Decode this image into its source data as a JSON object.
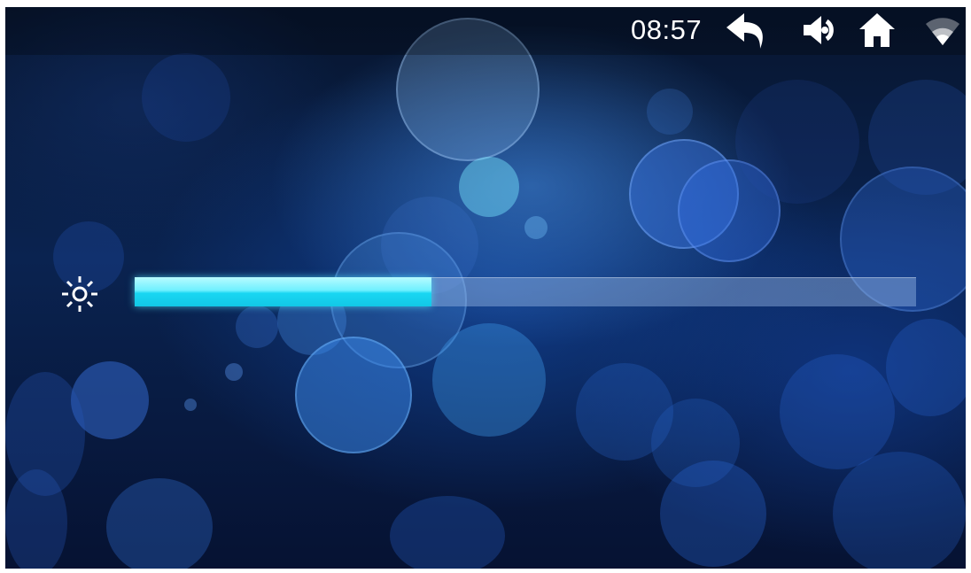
{
  "status_bar": {
    "time": "08:57",
    "icons": [
      "back-arrow-icon",
      "volume-icon",
      "home-icon",
      "wifi-icon"
    ]
  },
  "brightness": {
    "icon": "brightness-sun-icon",
    "level": 0.38
  },
  "colors": {
    "slider_fill": "#2fe0f5",
    "slider_track": "#7fa6d8",
    "status_text": "#ffffff"
  }
}
